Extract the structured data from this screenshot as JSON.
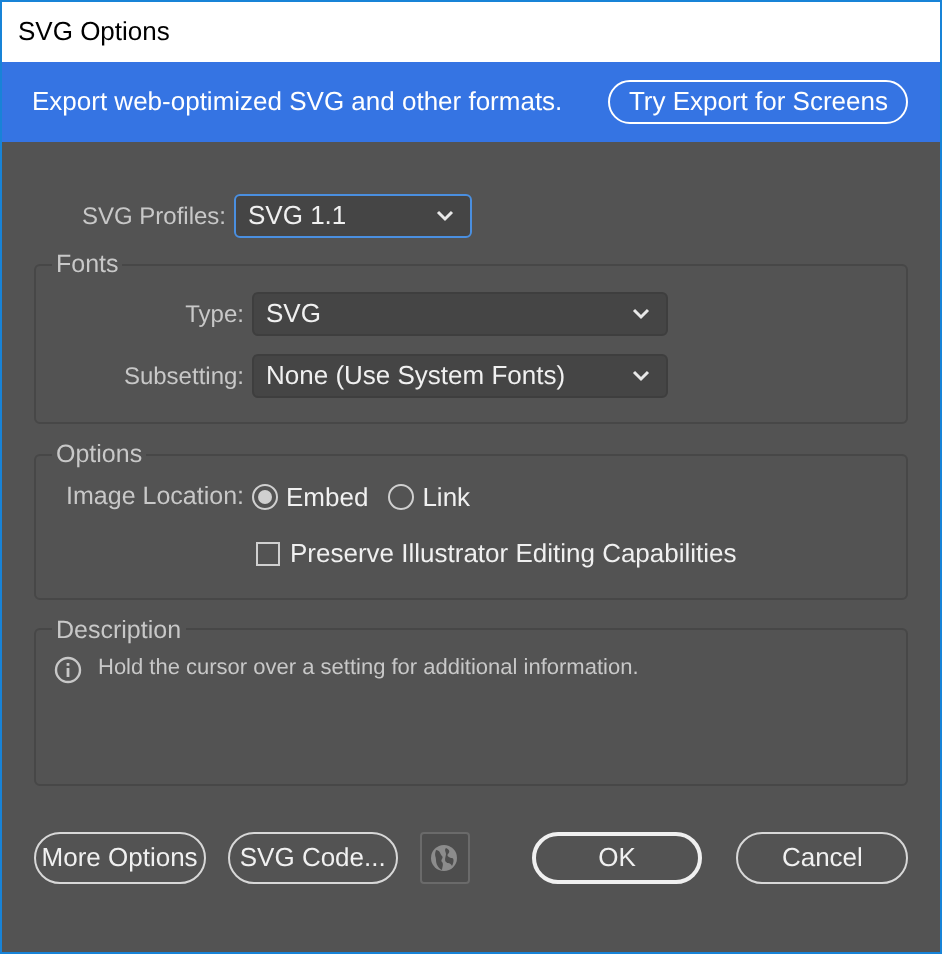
{
  "window": {
    "title": "SVG Options"
  },
  "banner": {
    "text": "Export web-optimized SVG and other formats.",
    "button": "Try Export for Screens"
  },
  "profile": {
    "label": "SVG Profiles:",
    "value": "SVG 1.1",
    "focused": true
  },
  "fonts": {
    "title": "Fonts",
    "fields": [
      {
        "label": "Type:",
        "value": "SVG"
      },
      {
        "label": "Subsetting:",
        "value": "None (Use System Fonts)"
      }
    ]
  },
  "options": {
    "title": "Options",
    "image_location": {
      "label": "Image Location:",
      "choices": [
        {
          "label": "Embed",
          "selected": true
        },
        {
          "label": "Link",
          "selected": false
        }
      ]
    },
    "preserve": {
      "label": "Preserve Illustrator Editing Capabilities",
      "checked": false
    }
  },
  "description": {
    "title": "Description",
    "text": "Hold the cursor over a setting for additional information."
  },
  "buttons": [
    {
      "label": "More Options",
      "kind": "pill"
    },
    {
      "label": "SVG Code...",
      "kind": "pill"
    },
    {
      "kind": "globe"
    },
    {
      "label": "OK",
      "kind": "default"
    },
    {
      "label": "Cancel",
      "kind": "pill"
    }
  ]
}
